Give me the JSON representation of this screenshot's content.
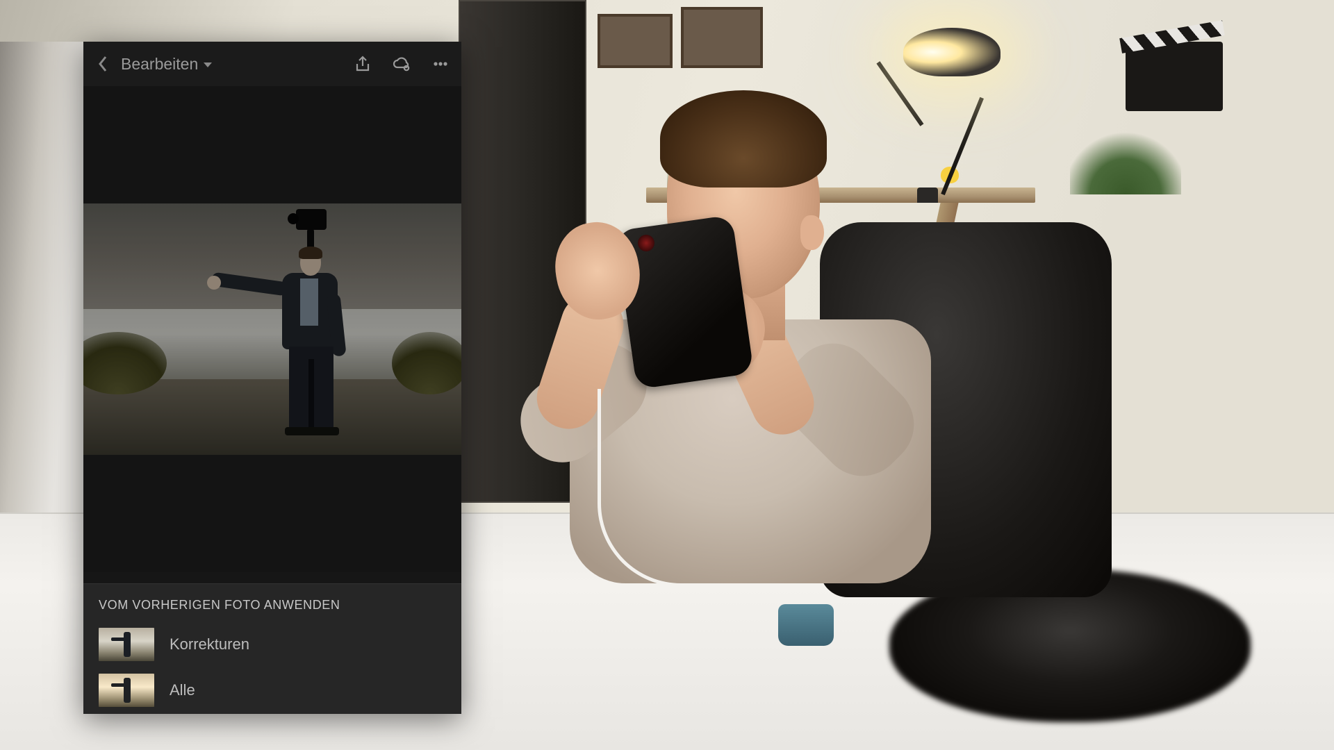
{
  "app": {
    "mode_label": "Bearbeiten",
    "icons": {
      "back": "chevron-left",
      "share": "share",
      "cloud": "cloud-sync",
      "more": "more-horizontal"
    },
    "sheet": {
      "title": "VOM VORHERIGEN FOTO ANWENDEN",
      "items": [
        {
          "label": "Korrekturen"
        },
        {
          "label": "Alle"
        }
      ]
    }
  },
  "scene": {
    "description": "Young man seated at a desk holding a smartphone, looking toward a monitor; desk lamp, shelf, plants and camera gear visible in background.",
    "phone_screen": "Adobe Lightroom Mobile edit view with action sheet open"
  }
}
